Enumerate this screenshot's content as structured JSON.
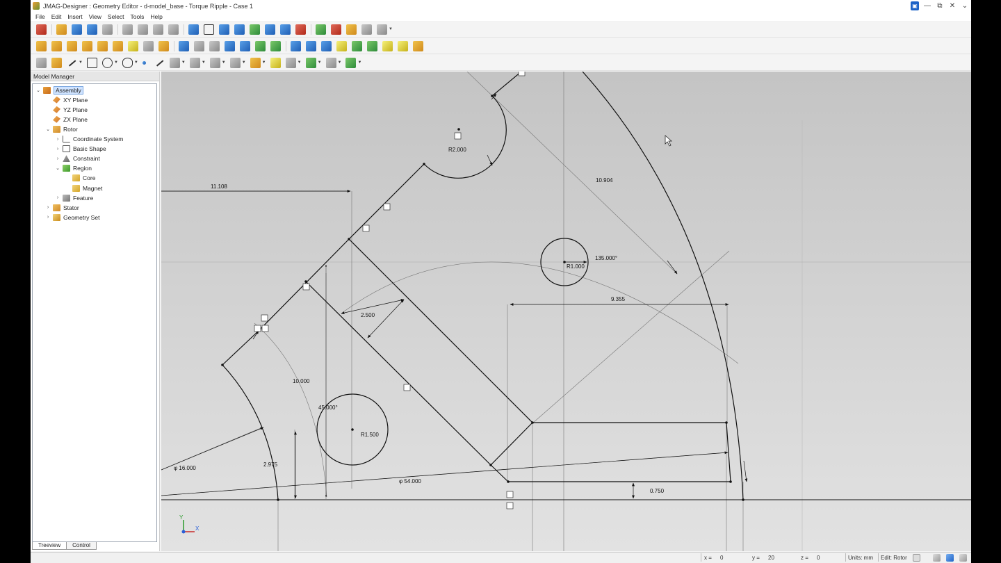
{
  "window": {
    "title": "JMAG-Designer : Geometry Editor - d-model_base - Torque Ripple - Case 1"
  },
  "menu": [
    "File",
    "Edit",
    "Insert",
    "View",
    "Select",
    "Tools",
    "Help"
  ],
  "model_manager": {
    "title": "Model Manager",
    "tree": [
      {
        "label": "Assembly",
        "icon": "assembly-icon",
        "depth": 0,
        "toggle": "expanded",
        "selected": true
      },
      {
        "label": "XY Plane",
        "icon": "plane-icon",
        "depth": 1,
        "toggle": "none"
      },
      {
        "label": "YZ Plane",
        "icon": "plane-icon",
        "depth": 1,
        "toggle": "none"
      },
      {
        "label": "ZX Plane",
        "icon": "plane-icon",
        "depth": 1,
        "toggle": "none"
      },
      {
        "label": "Rotor",
        "icon": "part-icon",
        "depth": 1,
        "toggle": "expanded"
      },
      {
        "label": "Coordinate System",
        "icon": "coordinate-system-icon",
        "depth": 2,
        "toggle": "collapsed"
      },
      {
        "label": "Basic Shape",
        "icon": "basic-shape-icon",
        "depth": 2,
        "toggle": "collapsed"
      },
      {
        "label": "Constraint",
        "icon": "constraint-icon",
        "depth": 2,
        "toggle": "collapsed"
      },
      {
        "label": "Region",
        "icon": "region-icon",
        "depth": 2,
        "toggle": "expanded"
      },
      {
        "label": "Core",
        "icon": "region-folder-icon",
        "depth": 3,
        "toggle": "none"
      },
      {
        "label": "Magnet",
        "icon": "region-folder-icon",
        "depth": 3,
        "toggle": "none"
      },
      {
        "label": "Feature",
        "icon": "feature-icon",
        "depth": 2,
        "toggle": "collapsed"
      },
      {
        "label": "Stator",
        "icon": "part-icon",
        "depth": 1,
        "toggle": "collapsed"
      },
      {
        "label": "Geometry Set",
        "icon": "geometry-set-icon",
        "depth": 1,
        "toggle": "collapsed"
      }
    ],
    "tabs": [
      "Treeview",
      "Control"
    ],
    "active_tab": "Treeview"
  },
  "dimensions": {
    "d11108": "11.108",
    "r2000": "R2.000",
    "d10904": "10.904",
    "a135": "135.000°",
    "r1000": "R1.000",
    "d9355": "9.355",
    "d2500": "2.500",
    "d10000": "10.000",
    "a45": "45.000°",
    "r1500": "R1.500",
    "phi16": "φ 16.000",
    "d2975": "2.975",
    "phi54": "φ 54.000",
    "d0750": "0.750"
  },
  "axis_triad": {
    "x": "X",
    "y": "Y"
  },
  "status": {
    "x_label": "x =",
    "x_value": "0",
    "y_label": "y =",
    "y_value": "20",
    "z_label": "z =",
    "z_value": "0",
    "units": "Units: mm",
    "edit": "Edit: Rotor"
  },
  "colors": {
    "accent": "#1e63c7",
    "selection": "#cfe3ff",
    "viewport_top": "#c4c4c4",
    "viewport_bottom": "#e2e2e2"
  }
}
